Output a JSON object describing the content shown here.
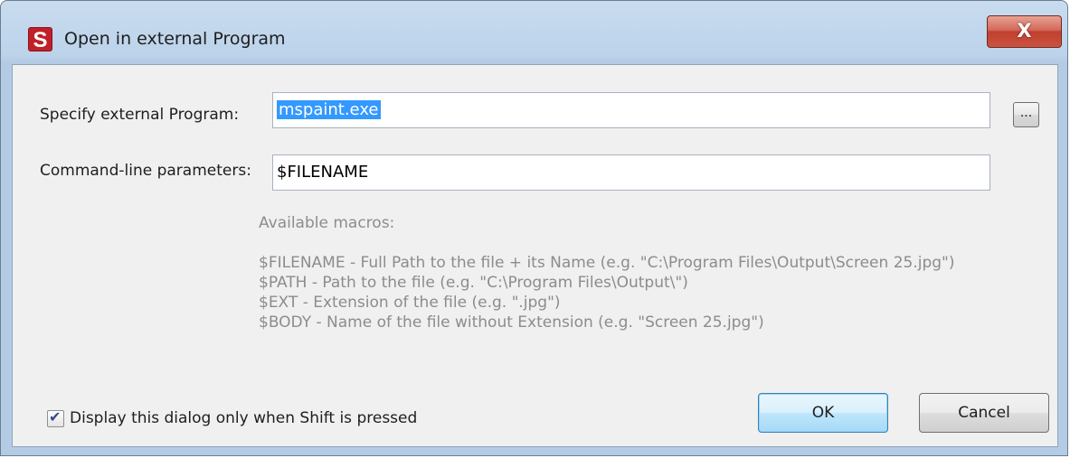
{
  "window": {
    "title": "Open in external Program",
    "icon_letter": "S",
    "close_glyph": "X"
  },
  "program": {
    "label": "Specify external Program:",
    "value": "mspaint.exe",
    "browse_label": "..."
  },
  "params": {
    "label": "Command-line parameters:",
    "value": "$FILENAME"
  },
  "macros": {
    "heading": "Available macros:",
    "items": [
      "$FILENAME - Full Path to the file + its Name (e.g. \"C:\\Program Files\\Output\\Screen 25.jpg\")",
      "$PATH - Path to the file (e.g. \"C:\\Program Files\\Output\\\")",
      "$EXT - Extension of the file (e.g. \".jpg\")",
      "$BODY - Name of the file without Extension (e.g. \"Screen 25.jpg\")"
    ]
  },
  "option": {
    "label": "Display this dialog only when Shift is pressed",
    "checked": true
  },
  "buttons": {
    "ok": "OK",
    "cancel": "Cancel"
  }
}
